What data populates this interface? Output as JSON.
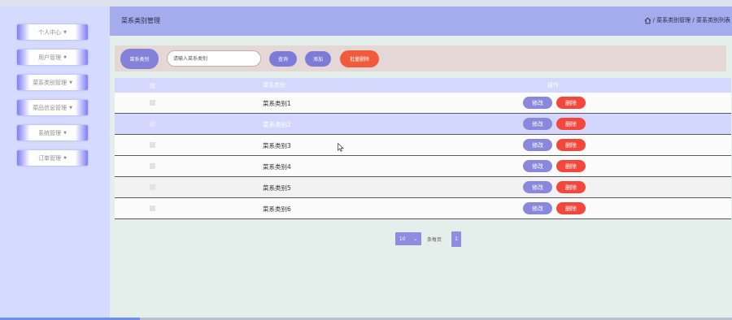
{
  "sidebar": {
    "items": [
      {
        "label": "个人中心"
      },
      {
        "label": "用户管理"
      },
      {
        "label": "菜系类别管理"
      },
      {
        "label": "菜品信息管理"
      },
      {
        "label": "系统管理"
      },
      {
        "label": "订单管理"
      }
    ]
  },
  "header": {
    "title": "菜系类别管理",
    "breadcrumb": "/ 菜系类别管理 / 菜系类别列表"
  },
  "search": {
    "label": "菜系类别",
    "placeholder": "请输入菜系类别",
    "query_label": "查询",
    "add_label": "添加",
    "batch_delete_label": "批量删除"
  },
  "table": {
    "headers": {
      "name": "菜系类别",
      "actions": "操作"
    },
    "rows": [
      {
        "name": "菜系类别1",
        "highlighted": false
      },
      {
        "name": "菜系类别2",
        "highlighted": true
      },
      {
        "name": "菜系类别3",
        "highlighted": false
      },
      {
        "name": "菜系类别4",
        "highlighted": false
      },
      {
        "name": "菜系类别5",
        "highlighted": false
      },
      {
        "name": "菜系类别6",
        "highlighted": false
      }
    ],
    "edit_label": "修改",
    "delete_label": "删除"
  },
  "pagination": {
    "page_size": "10",
    "per_page_label": "条每页",
    "current_page": "1"
  },
  "colors": {
    "sidebar_bg": "#d4dbff",
    "header_bg": "#a4acee",
    "accent": "#7d7bd8",
    "danger": "#f3473c"
  }
}
